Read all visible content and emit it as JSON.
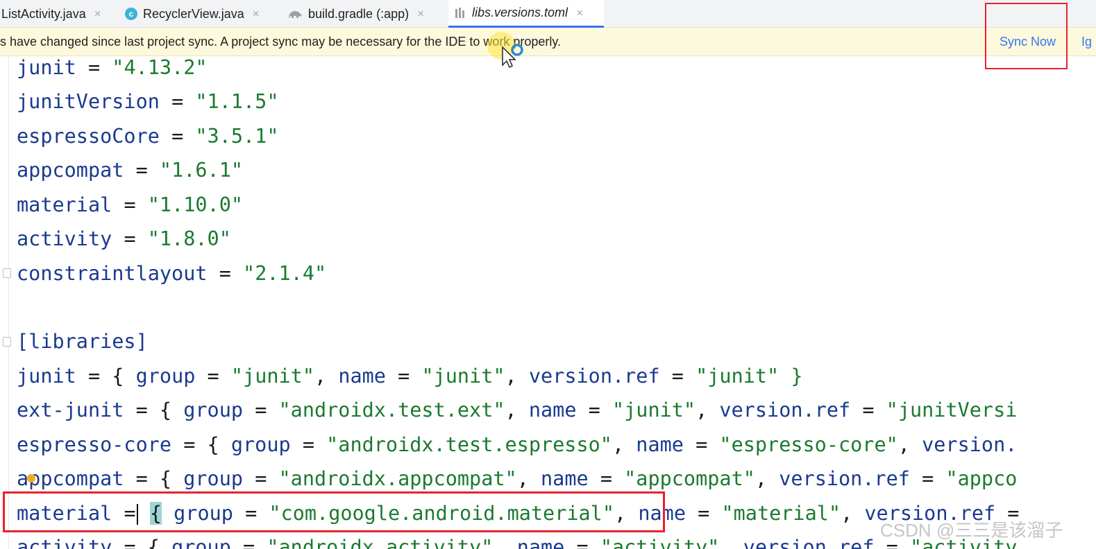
{
  "tabs": [
    {
      "label": "ListActivity.java",
      "close": "×"
    },
    {
      "label": "RecyclerView.java",
      "close": "×"
    },
    {
      "label": "build.gradle (:app)",
      "close": "×"
    },
    {
      "label": "libs.versions.toml",
      "close": "×"
    }
  ],
  "banner": {
    "message": "s have changed since last project sync. A project sync may be necessary for the IDE to work properly.",
    "sync_now": "Sync Now",
    "ignore": "Ig"
  },
  "code": {
    "versions": [
      {
        "key": "junit",
        "value": "\"4.13.2\""
      },
      {
        "key": "junitVersion",
        "value": "\"1.1.5\""
      },
      {
        "key": "espressoCore",
        "value": "\"3.5.1\""
      },
      {
        "key": "appcompat",
        "value": "\"1.6.1\""
      },
      {
        "key": "material",
        "value": "\"1.10.0\""
      },
      {
        "key": "activity",
        "value": "\"1.8.0\""
      },
      {
        "key": "constraintlayout",
        "value": "\"2.1.4\""
      }
    ],
    "section_header": "[libraries]",
    "libraries": [
      {
        "key": "junit",
        "group": "\"junit\"",
        "name": "\"junit\"",
        "ref": "\"junit\" }"
      },
      {
        "key": "ext-junit",
        "group": "\"androidx.test.ext\"",
        "name": "\"junit\"",
        "ref": "\"junitVersi"
      },
      {
        "key": "espresso-core",
        "group": "\"androidx.test.espresso\"",
        "name": "\"espresso-core\"",
        "ref": ""
      },
      {
        "key": "appcompat",
        "group": "\"androidx.appcompat\"",
        "name": "\"appcompat\"",
        "ref": "\"appco"
      },
      {
        "key": "material",
        "group": "\"com.google.android.material\"",
        "name": "\"material\"",
        "ref": ""
      },
      {
        "key": "activity",
        "group": "\"androidx.activity\"",
        "name": "\"activity\"",
        "ref": "\"activity"
      }
    ],
    "tokens": {
      "group": "group",
      "name": "name",
      "version_ref": "version.ref",
      "version": "version."
    }
  },
  "watermark": "CSDN @三三是该溜子",
  "colors": {
    "accent": "#3574f0",
    "highlight_red": "#e8222c",
    "string_green": "#1b7a2f",
    "key_blue": "#1a3a8f"
  },
  "icons": [
    "java-class-icon",
    "gradle-icon",
    "toml-file-icon",
    "close-icon"
  ]
}
